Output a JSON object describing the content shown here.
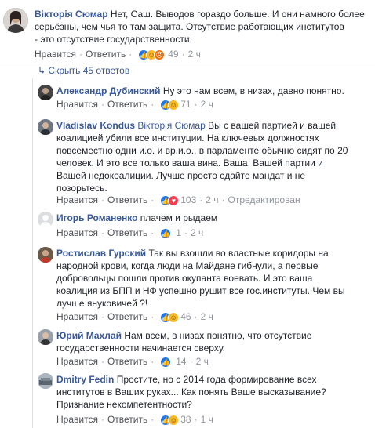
{
  "top_comment": {
    "author": "Вікторія Сюмар",
    "lines": [
      "Нет, Саш. Выводов гораздо больше. И они намного более",
      "серьёзны, чем чья то там защита. Отсутствие работающих институтов",
      "- это отсутствие государственности."
    ],
    "like_label": "Нравится",
    "reply_label": "Ответить",
    "reactions": [
      "like",
      "haha",
      "angry"
    ],
    "reaction_count": "49",
    "time": "2 ч"
  },
  "replies_toggle": "Скрыть 45 ответов",
  "replies": [
    {
      "author": "Александр Дубинский",
      "mention": "",
      "lines": [
        "Ну это нам всем, в низах, давно понятно."
      ],
      "like_label": "Нравится",
      "reply_label": "Ответить",
      "reactions": [
        "like",
        "haha"
      ],
      "reaction_count": "71",
      "time": "2 ч",
      "edited": ""
    },
    {
      "author": "Vladislav Kondus",
      "mention": "Вікторія Сюмар",
      "lines": [
        "Вы с вашей партией и вашей",
        "коалицией убили все институции. На ключевых должностях",
        "повсеместно одни и.о. и вр.и.о., в парламенте обычно сидят по 20",
        "человек. И это все только ваша вина. Ваша, Вашей партии и",
        "Вашей недокоалиции. Лучше просто сдайте мандат и не",
        "позорьтесь."
      ],
      "like_label": "Нравится",
      "reply_label": "Ответить",
      "reactions": [
        "like",
        "love"
      ],
      "reaction_count": "103",
      "time": "2 ч",
      "edited": "Отредактирован"
    },
    {
      "author": "Игорь Романенко",
      "mention": "",
      "lines": [
        "плачем и рыдаем"
      ],
      "like_label": "Нравится",
      "reply_label": "Ответить",
      "reactions": [
        "like"
      ],
      "reaction_count": "1",
      "time": "2 ч",
      "edited": ""
    },
    {
      "author": "Ростислав Гурский",
      "mention": "",
      "lines": [
        "Так вы взошли во властные коридоры на",
        "народной крови, когда люди на Майдане гибнули, а первые",
        "добровольцы пошли против окупанта воевать. И это ваша",
        "коалиция из БПП и НФ успешно рушит все гос.институты. Чем вы",
        "лучше януковичей ?!"
      ],
      "like_label": "Нравится",
      "reply_label": "Ответить",
      "reactions": [
        "like",
        "haha"
      ],
      "reaction_count": "46",
      "time": "2 ч",
      "edited": ""
    },
    {
      "author": "Юрий Махлай",
      "mention": "",
      "lines": [
        "Нам всем, в низах понятно, что отсутствие",
        "государственности начинается сверху."
      ],
      "like_label": "Нравится",
      "reply_label": "Ответить",
      "reactions": [
        "like"
      ],
      "reaction_count": "14",
      "time": "2 ч",
      "edited": ""
    },
    {
      "author": "Dmitry Fedin",
      "mention": "",
      "lines": [
        "Простите, но с 2014 года формирование всех",
        "институтов в Ваших руках... Как понять Ваше высказывание?",
        "Признание некомпетентности?"
      ],
      "like_label": "Нравится",
      "reply_label": "Ответить",
      "reactions": [
        "like",
        "haha"
      ],
      "reaction_count": "38",
      "time": "1 ч",
      "edited": ""
    }
  ]
}
